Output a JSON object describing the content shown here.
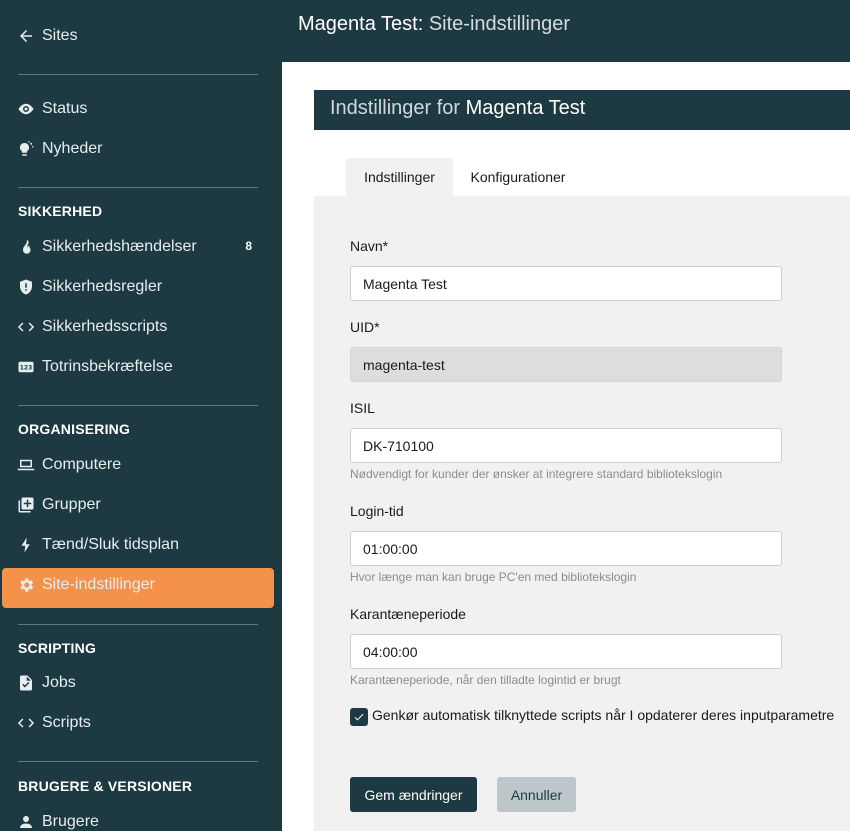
{
  "sidebar": {
    "back_label": "Sites",
    "items_top": [
      {
        "label": "Status",
        "icon": "eye-icon"
      },
      {
        "label": "Nyheder",
        "icon": "lightbulb-icon"
      }
    ],
    "sections": [
      {
        "heading": "SIKKERHED",
        "items": [
          {
            "label": "Sikkerhedshændelser",
            "icon": "fire-icon",
            "badge": "8"
          },
          {
            "label": "Sikkerhedsregler",
            "icon": "shield-icon"
          },
          {
            "label": "Sikkerhedsscripts",
            "icon": "code-icon"
          },
          {
            "label": "Totrinsbekræftelse",
            "icon": "numbers-123-icon"
          }
        ]
      },
      {
        "heading": "ORGANISERING",
        "items": [
          {
            "label": "Computere",
            "icon": "laptop-icon"
          },
          {
            "label": "Grupper",
            "icon": "add-group-icon"
          },
          {
            "label": "Tænd/Sluk tidsplan",
            "icon": "bolt-icon"
          },
          {
            "label": "Site-indstillinger",
            "icon": "gear-icon",
            "active": true
          }
        ]
      },
      {
        "heading": "SCRIPTING",
        "items": [
          {
            "label": "Jobs",
            "icon": "file-check-icon"
          },
          {
            "label": "Scripts",
            "icon": "code-icon"
          }
        ]
      },
      {
        "heading": "BRUGERE & VERSIONER",
        "items": [
          {
            "label": "Brugere",
            "icon": "user-icon"
          }
        ]
      }
    ],
    "active_color": "#f4914a",
    "bg_color": "#1d3a43"
  },
  "header": {
    "site_name": "Magenta Test",
    "page_name": "Site-indstillinger"
  },
  "main": {
    "section_title_prefix": "Indstillinger for",
    "section_title_site": "Magenta Test",
    "tabs": [
      {
        "label": "Indstillinger",
        "active": true
      },
      {
        "label": "Konfigurationer",
        "active": false
      }
    ],
    "form": {
      "name_label": "Navn*",
      "name_value": "Magenta Test",
      "uid_label": "UID*",
      "uid_value": "magenta-test",
      "isil_label": "ISIL",
      "isil_value": "DK-710100",
      "isil_help": "Nødvendigt for kunder der ønsker at integrere standard bibliotekslogin",
      "login_label": "Login-tid",
      "login_value": "01:00:00",
      "login_help": "Hvor længe man kan bruge PC'en med bibliotekslogin",
      "quarantine_label": "Karantæneperiode",
      "quarantine_value": "04:00:00",
      "quarantine_help": "Karantæneperiode, når den tilladte logintid er brugt",
      "rerun_label": "Genkør automatisk tilknyttede scripts når I opdaterer deres inputparametre",
      "rerun_checked": true
    },
    "buttons": {
      "save_label": "Gem ændringer",
      "cancel_label": "Annuller"
    }
  }
}
